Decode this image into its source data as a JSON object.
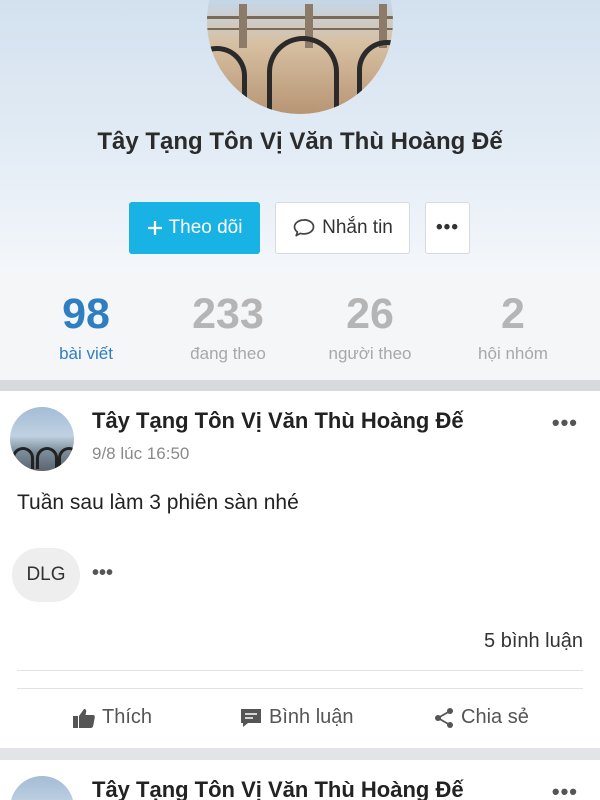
{
  "profile": {
    "name": "Tây Tạng Tôn Vị Văn Thù Hoàng Đế",
    "follow_label": "Theo dõi",
    "message_label": "Nhắn tin",
    "more_label": "•••"
  },
  "stats": [
    {
      "value": "98",
      "label": "bài viết",
      "active": true
    },
    {
      "value": "233",
      "label": "đang theo",
      "active": false
    },
    {
      "value": "26",
      "label": "người theo",
      "active": false
    },
    {
      "value": "2",
      "label": "hội nhóm",
      "active": false
    }
  ],
  "posts": [
    {
      "author": "Tây Tạng Tôn Vị Văn Thù Hoàng Đế",
      "time": "9/8 lúc 16:50",
      "text": "Tuần sau làm 3 phiên sàn nhé",
      "reactor": "DLG",
      "reactor_more": "•••",
      "comment_count": "5 bình luận",
      "more": "•••",
      "actions": {
        "like": "Thích",
        "comment": "Bình luận",
        "share": "Chia sẻ"
      }
    },
    {
      "author": "Tây Tạng Tôn Vị Văn Thù Hoàng Đế",
      "more": "•••"
    }
  ],
  "colors": {
    "accent": "#18b2e4",
    "stat_active": "#2e7fc2",
    "stat_inactive": "#b5b5b5"
  },
  "icons": [
    "plus-icon",
    "chat-bubble-icon",
    "thumbs-up-icon",
    "comment-icon",
    "share-icon"
  ]
}
